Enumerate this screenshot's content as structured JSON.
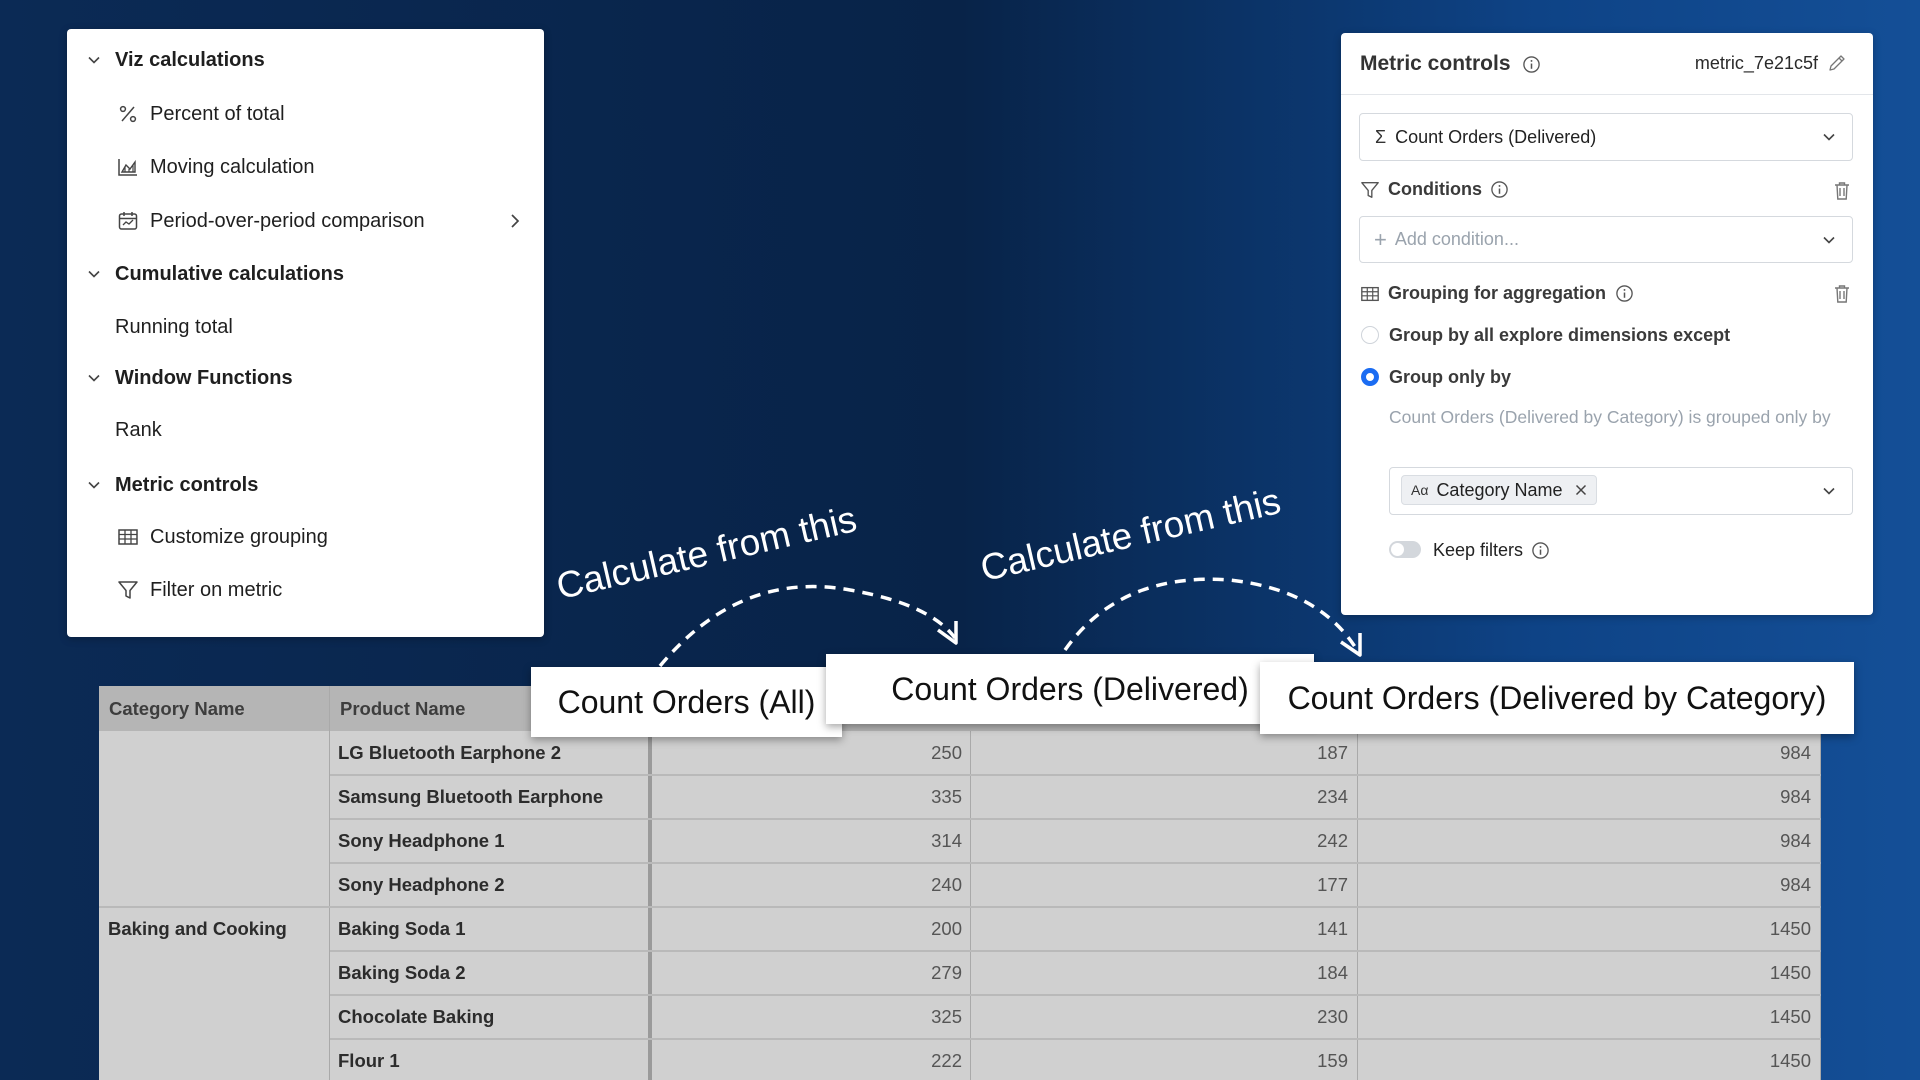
{
  "menu": {
    "sections": [
      {
        "label": "Viz calculations",
        "items": [
          "Percent of total",
          "Moving calculation",
          "Period-over-period comparison"
        ]
      },
      {
        "label": "Cumulative calculations",
        "items": [
          "Running total"
        ]
      },
      {
        "label": "Window Functions",
        "items": [
          "Rank"
        ]
      },
      {
        "label": "Metric controls",
        "items": [
          "Customize grouping",
          "Filter on metric"
        ]
      }
    ]
  },
  "metric_controls": {
    "title": "Metric controls",
    "metric_id": "metric_7e21c5f",
    "metric_select": "Count Orders (Delivered)",
    "conditions_label": "Conditions",
    "add_condition_placeholder": "Add condition...",
    "grouping_label": "Grouping for aggregation",
    "radio_options": [
      "Group by all explore dimensions except",
      "Group only by"
    ],
    "selected_radio": "Group only by",
    "help_text": "Count Orders (Delivered by Category) is grouped only by",
    "chip_prefix": "Aα",
    "chip_label": "Category Name",
    "keep_filters_label": "Keep filters",
    "keep_filters_on": false
  },
  "annotations": {
    "left": "Calculate from this",
    "right": "Calculate from this"
  },
  "callouts": {
    "all": "Count Orders (All)",
    "delivered": "Count Orders (Delivered)",
    "by_category": "Count Orders (Delivered by Category)"
  },
  "table": {
    "headers": {
      "category": "Category Name",
      "product": "Product Name"
    },
    "rows": [
      {
        "category": "",
        "product": "LG Bluetooth Earphone 2",
        "all": "250",
        "delivered": "187",
        "by_category": "984"
      },
      {
        "category": "",
        "product": "Samsung Bluetooth Earphone",
        "all": "335",
        "delivered": "234",
        "by_category": "984"
      },
      {
        "category": "",
        "product": "Sony Headphone 1",
        "all": "314",
        "delivered": "242",
        "by_category": "984"
      },
      {
        "category": "",
        "product": "Sony Headphone 2",
        "all": "240",
        "delivered": "177",
        "by_category": "984"
      },
      {
        "category": "Baking and Cooking",
        "product": "Baking Soda 1",
        "all": "200",
        "delivered": "141",
        "by_category": "1450"
      },
      {
        "category": "",
        "product": "Baking Soda 2",
        "all": "279",
        "delivered": "184",
        "by_category": "1450"
      },
      {
        "category": "",
        "product": "Chocolate Baking",
        "all": "325",
        "delivered": "230",
        "by_category": "1450"
      },
      {
        "category": "",
        "product": "Flour 1",
        "all": "222",
        "delivered": "159",
        "by_category": "1450"
      }
    ]
  }
}
